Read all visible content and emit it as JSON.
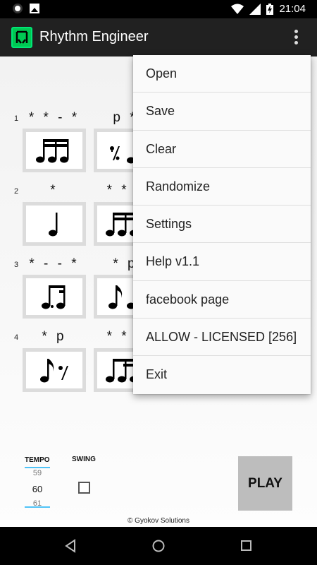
{
  "status_bar": {
    "time": "21:04"
  },
  "app_bar": {
    "title": "Rhythm Engineer"
  },
  "rows": [
    {
      "number": "1",
      "patterns": [
        "* * - *",
        "p *"
      ]
    },
    {
      "number": "2",
      "patterns": [
        "*",
        "* * *"
      ]
    },
    {
      "number": "3",
      "patterns": [
        "* - - *",
        "* p"
      ]
    },
    {
      "number": "4",
      "patterns": [
        "* p",
        "* * *"
      ]
    }
  ],
  "controls": {
    "tempo_label": "TEMPO",
    "tempo_prev": "59",
    "tempo_value": "60",
    "tempo_next": "61",
    "swing_label": "SWING",
    "swing_checked": false,
    "play_label": "PLAY"
  },
  "footer": {
    "copyright": "© Gyokov Solutions"
  },
  "menu": {
    "items": [
      "Open",
      "Save",
      "Clear",
      "Randomize",
      "Settings",
      "Help v1.1",
      "facebook page",
      "ALLOW - LICENSED [256]",
      "Exit"
    ]
  }
}
